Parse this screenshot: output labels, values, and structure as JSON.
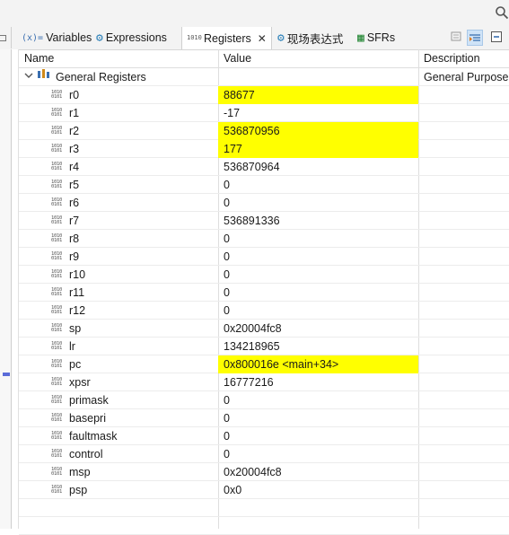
{
  "tabs": [
    {
      "icon": "(x)=",
      "label": "Variables"
    },
    {
      "icon": "⚙",
      "label": "Expressions"
    },
    {
      "icon": "1010",
      "label": "Registers",
      "active": true
    },
    {
      "icon": "⚙",
      "label": "现场表达式"
    },
    {
      "icon": "▦",
      "label": "SFRs"
    }
  ],
  "columns": {
    "name": "Name",
    "value": "Value",
    "description": "Description"
  },
  "group": {
    "name": "General Registers",
    "description": "General Purpose"
  },
  "registers": [
    {
      "name": "r0",
      "value": "88677",
      "changed": true
    },
    {
      "name": "r1",
      "value": "-17",
      "changed": false
    },
    {
      "name": "r2",
      "value": "536870956",
      "changed": true
    },
    {
      "name": "r3",
      "value": "177",
      "changed": true
    },
    {
      "name": "r4",
      "value": "536870964",
      "changed": false
    },
    {
      "name": "r5",
      "value": "0",
      "changed": false
    },
    {
      "name": "r6",
      "value": "0",
      "changed": false
    },
    {
      "name": "r7",
      "value": "536891336",
      "changed": false
    },
    {
      "name": "r8",
      "value": "0",
      "changed": false
    },
    {
      "name": "r9",
      "value": "0",
      "changed": false
    },
    {
      "name": "r10",
      "value": "0",
      "changed": false
    },
    {
      "name": "r11",
      "value": "0",
      "changed": false
    },
    {
      "name": "r12",
      "value": "0",
      "changed": false
    },
    {
      "name": "sp",
      "value": "0x20004fc8",
      "changed": false
    },
    {
      "name": "lr",
      "value": "134218965",
      "changed": false
    },
    {
      "name": "pc",
      "value": "0x800016e <main+34>",
      "changed": true
    },
    {
      "name": "xpsr",
      "value": "16777216",
      "changed": false
    },
    {
      "name": "primask",
      "value": "0",
      "changed": false
    },
    {
      "name": "basepri",
      "value": "0",
      "changed": false
    },
    {
      "name": "faultmask",
      "value": "0",
      "changed": false
    },
    {
      "name": "control",
      "value": "0",
      "changed": false
    },
    {
      "name": "msp",
      "value": "0x20004fc8",
      "changed": false
    },
    {
      "name": "psp",
      "value": "0x0",
      "changed": false
    }
  ],
  "highlight_color": "#ffff00"
}
